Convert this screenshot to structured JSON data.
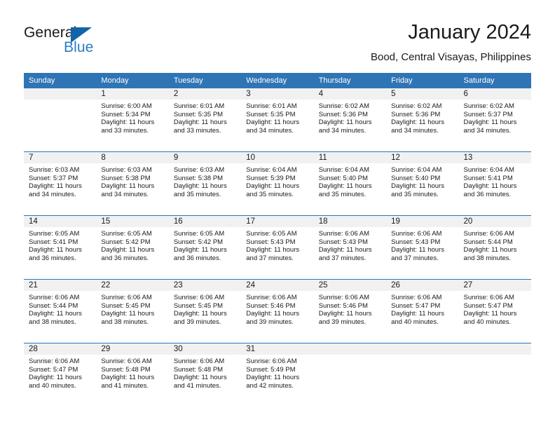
{
  "brand": {
    "name_part1": "General",
    "name_part2": "Blue",
    "triangle_color": "#1263a8",
    "blue_text_color": "#2b7cc4"
  },
  "header": {
    "title": "January 2024",
    "location": "Bood, Central Visayas, Philippines"
  },
  "theme": {
    "header_blue": "#2f75b5",
    "daynum_band": "#f1f1f1",
    "text": "#1a1a1a"
  },
  "weekday_headers": [
    "Sunday",
    "Monday",
    "Tuesday",
    "Wednesday",
    "Thursday",
    "Friday",
    "Saturday"
  ],
  "calendar": {
    "weeks": [
      [
        {
          "day": "",
          "sunrise": "",
          "sunset": "",
          "daylight_line1": "",
          "daylight_line2": ""
        },
        {
          "day": "1",
          "sunrise": "Sunrise: 6:00 AM",
          "sunset": "Sunset: 5:34 PM",
          "daylight_line1": "Daylight: 11 hours",
          "daylight_line2": "and 33 minutes."
        },
        {
          "day": "2",
          "sunrise": "Sunrise: 6:01 AM",
          "sunset": "Sunset: 5:35 PM",
          "daylight_line1": "Daylight: 11 hours",
          "daylight_line2": "and 33 minutes."
        },
        {
          "day": "3",
          "sunrise": "Sunrise: 6:01 AM",
          "sunset": "Sunset: 5:35 PM",
          "daylight_line1": "Daylight: 11 hours",
          "daylight_line2": "and 34 minutes."
        },
        {
          "day": "4",
          "sunrise": "Sunrise: 6:02 AM",
          "sunset": "Sunset: 5:36 PM",
          "daylight_line1": "Daylight: 11 hours",
          "daylight_line2": "and 34 minutes."
        },
        {
          "day": "5",
          "sunrise": "Sunrise: 6:02 AM",
          "sunset": "Sunset: 5:36 PM",
          "daylight_line1": "Daylight: 11 hours",
          "daylight_line2": "and 34 minutes."
        },
        {
          "day": "6",
          "sunrise": "Sunrise: 6:02 AM",
          "sunset": "Sunset: 5:37 PM",
          "daylight_line1": "Daylight: 11 hours",
          "daylight_line2": "and 34 minutes."
        }
      ],
      [
        {
          "day": "7",
          "sunrise": "Sunrise: 6:03 AM",
          "sunset": "Sunset: 5:37 PM",
          "daylight_line1": "Daylight: 11 hours",
          "daylight_line2": "and 34 minutes."
        },
        {
          "day": "8",
          "sunrise": "Sunrise: 6:03 AM",
          "sunset": "Sunset: 5:38 PM",
          "daylight_line1": "Daylight: 11 hours",
          "daylight_line2": "and 34 minutes."
        },
        {
          "day": "9",
          "sunrise": "Sunrise: 6:03 AM",
          "sunset": "Sunset: 5:38 PM",
          "daylight_line1": "Daylight: 11 hours",
          "daylight_line2": "and 35 minutes."
        },
        {
          "day": "10",
          "sunrise": "Sunrise: 6:04 AM",
          "sunset": "Sunset: 5:39 PM",
          "daylight_line1": "Daylight: 11 hours",
          "daylight_line2": "and 35 minutes."
        },
        {
          "day": "11",
          "sunrise": "Sunrise: 6:04 AM",
          "sunset": "Sunset: 5:40 PM",
          "daylight_line1": "Daylight: 11 hours",
          "daylight_line2": "and 35 minutes."
        },
        {
          "day": "12",
          "sunrise": "Sunrise: 6:04 AM",
          "sunset": "Sunset: 5:40 PM",
          "daylight_line1": "Daylight: 11 hours",
          "daylight_line2": "and 35 minutes."
        },
        {
          "day": "13",
          "sunrise": "Sunrise: 6:04 AM",
          "sunset": "Sunset: 5:41 PM",
          "daylight_line1": "Daylight: 11 hours",
          "daylight_line2": "and 36 minutes."
        }
      ],
      [
        {
          "day": "14",
          "sunrise": "Sunrise: 6:05 AM",
          "sunset": "Sunset: 5:41 PM",
          "daylight_line1": "Daylight: 11 hours",
          "daylight_line2": "and 36 minutes."
        },
        {
          "day": "15",
          "sunrise": "Sunrise: 6:05 AM",
          "sunset": "Sunset: 5:42 PM",
          "daylight_line1": "Daylight: 11 hours",
          "daylight_line2": "and 36 minutes."
        },
        {
          "day": "16",
          "sunrise": "Sunrise: 6:05 AM",
          "sunset": "Sunset: 5:42 PM",
          "daylight_line1": "Daylight: 11 hours",
          "daylight_line2": "and 36 minutes."
        },
        {
          "day": "17",
          "sunrise": "Sunrise: 6:05 AM",
          "sunset": "Sunset: 5:43 PM",
          "daylight_line1": "Daylight: 11 hours",
          "daylight_line2": "and 37 minutes."
        },
        {
          "day": "18",
          "sunrise": "Sunrise: 6:06 AM",
          "sunset": "Sunset: 5:43 PM",
          "daylight_line1": "Daylight: 11 hours",
          "daylight_line2": "and 37 minutes."
        },
        {
          "day": "19",
          "sunrise": "Sunrise: 6:06 AM",
          "sunset": "Sunset: 5:43 PM",
          "daylight_line1": "Daylight: 11 hours",
          "daylight_line2": "and 37 minutes."
        },
        {
          "day": "20",
          "sunrise": "Sunrise: 6:06 AM",
          "sunset": "Sunset: 5:44 PM",
          "daylight_line1": "Daylight: 11 hours",
          "daylight_line2": "and 38 minutes."
        }
      ],
      [
        {
          "day": "21",
          "sunrise": "Sunrise: 6:06 AM",
          "sunset": "Sunset: 5:44 PM",
          "daylight_line1": "Daylight: 11 hours",
          "daylight_line2": "and 38 minutes."
        },
        {
          "day": "22",
          "sunrise": "Sunrise: 6:06 AM",
          "sunset": "Sunset: 5:45 PM",
          "daylight_line1": "Daylight: 11 hours",
          "daylight_line2": "and 38 minutes."
        },
        {
          "day": "23",
          "sunrise": "Sunrise: 6:06 AM",
          "sunset": "Sunset: 5:45 PM",
          "daylight_line1": "Daylight: 11 hours",
          "daylight_line2": "and 39 minutes."
        },
        {
          "day": "24",
          "sunrise": "Sunrise: 6:06 AM",
          "sunset": "Sunset: 5:46 PM",
          "daylight_line1": "Daylight: 11 hours",
          "daylight_line2": "and 39 minutes."
        },
        {
          "day": "25",
          "sunrise": "Sunrise: 6:06 AM",
          "sunset": "Sunset: 5:46 PM",
          "daylight_line1": "Daylight: 11 hours",
          "daylight_line2": "and 39 minutes."
        },
        {
          "day": "26",
          "sunrise": "Sunrise: 6:06 AM",
          "sunset": "Sunset: 5:47 PM",
          "daylight_line1": "Daylight: 11 hours",
          "daylight_line2": "and 40 minutes."
        },
        {
          "day": "27",
          "sunrise": "Sunrise: 6:06 AM",
          "sunset": "Sunset: 5:47 PM",
          "daylight_line1": "Daylight: 11 hours",
          "daylight_line2": "and 40 minutes."
        }
      ],
      [
        {
          "day": "28",
          "sunrise": "Sunrise: 6:06 AM",
          "sunset": "Sunset: 5:47 PM",
          "daylight_line1": "Daylight: 11 hours",
          "daylight_line2": "and 40 minutes."
        },
        {
          "day": "29",
          "sunrise": "Sunrise: 6:06 AM",
          "sunset": "Sunset: 5:48 PM",
          "daylight_line1": "Daylight: 11 hours",
          "daylight_line2": "and 41 minutes."
        },
        {
          "day": "30",
          "sunrise": "Sunrise: 6:06 AM",
          "sunset": "Sunset: 5:48 PM",
          "daylight_line1": "Daylight: 11 hours",
          "daylight_line2": "and 41 minutes."
        },
        {
          "day": "31",
          "sunrise": "Sunrise: 6:06 AM",
          "sunset": "Sunset: 5:49 PM",
          "daylight_line1": "Daylight: 11 hours",
          "daylight_line2": "and 42 minutes."
        },
        {
          "day": "",
          "sunrise": "",
          "sunset": "",
          "daylight_line1": "",
          "daylight_line2": ""
        },
        {
          "day": "",
          "sunrise": "",
          "sunset": "",
          "daylight_line1": "",
          "daylight_line2": ""
        },
        {
          "day": "",
          "sunrise": "",
          "sunset": "",
          "daylight_line1": "",
          "daylight_line2": ""
        }
      ]
    ]
  }
}
